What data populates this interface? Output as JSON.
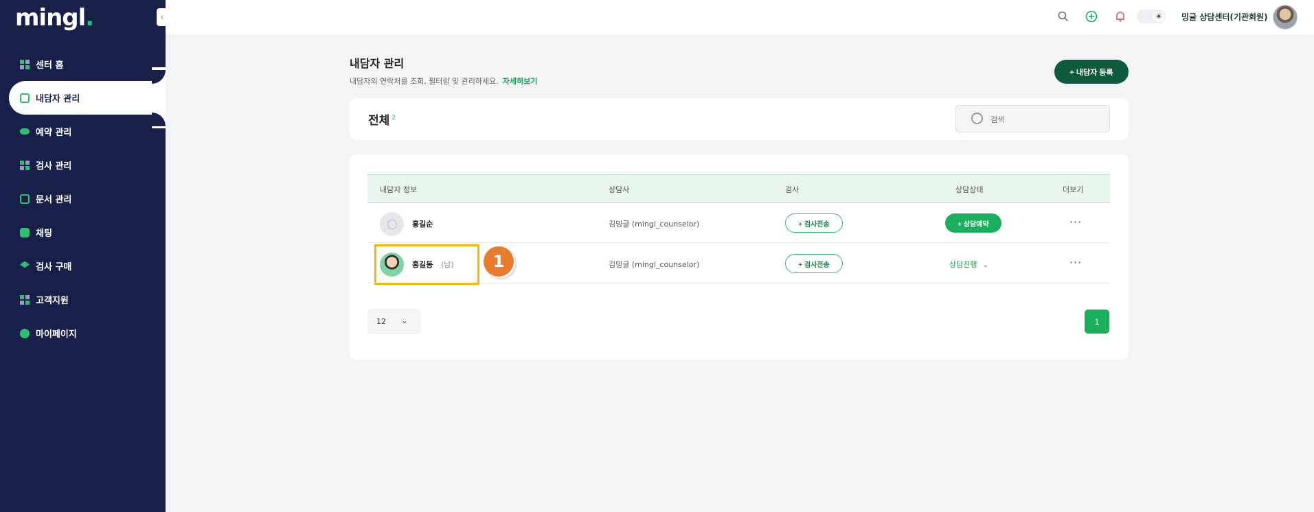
{
  "app": {
    "logo_text": "mingl",
    "logo_dot": "."
  },
  "sidebar": {
    "collapse_glyph": "‹",
    "items": [
      {
        "label": "센터 홈",
        "icon": "grid-icon"
      },
      {
        "label": "내담자 관리",
        "icon": "user-card-icon",
        "active": true
      },
      {
        "label": "예약 관리",
        "icon": "toggle-icon"
      },
      {
        "label": "검사 관리",
        "icon": "grid-icon"
      },
      {
        "label": "문서 관리",
        "icon": "document-icon"
      },
      {
        "label": "채팅",
        "icon": "chat-icon"
      },
      {
        "label": "검사 구매",
        "icon": "graduation-cap-icon"
      },
      {
        "label": "고객지원",
        "icon": "grid-icon"
      },
      {
        "label": "마이페이지",
        "icon": "person-icon"
      }
    ]
  },
  "header": {
    "user_name": "밍글 상담센터(기관회원)"
  },
  "page": {
    "title": "내담자 관리",
    "description": "내담자의 연락처를 조회, 필터링 및 관리하세요.",
    "detail_link": "자세히보기",
    "register_button": "+ 내담자 등록"
  },
  "filter": {
    "title": "전체",
    "count": "2",
    "search_placeholder": "검색"
  },
  "table": {
    "headers": [
      "내담자 정보",
      "상담사",
      "검사",
      "상담상태",
      "더보기"
    ],
    "rows": [
      {
        "name": "홍길순",
        "gender": "",
        "counselor": "김밍글 (mingl_counselor)",
        "test_button": "+ 검사전송",
        "status_button": "+ 상담예약",
        "more": "···"
      },
      {
        "name": "홍길동",
        "gender": "(남)",
        "counselor": "김밍글 (mingl_counselor)",
        "test_button": "+ 검사전송",
        "status": "상담진행",
        "more": "···"
      }
    ]
  },
  "annotation": {
    "step": "1"
  },
  "pagination": {
    "per_page": "12",
    "current_page": "1"
  },
  "colors": {
    "sidebar_bg": "#18204a",
    "accent_green": "#1aaf5d",
    "dark_green": "#0e5a3c",
    "highlight": "#f5b800",
    "badge": "#e87d2f"
  }
}
